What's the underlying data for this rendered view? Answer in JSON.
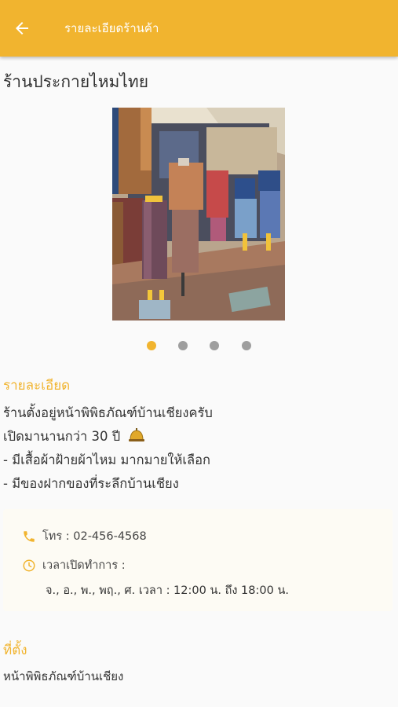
{
  "appbar": {
    "title": "รายละเอียดร้านค้า",
    "back_icon": "arrow-left-icon"
  },
  "shop": {
    "name": "ร้านประกายไหมไทย"
  },
  "carousel": {
    "total": 4,
    "active_index": 0
  },
  "details": {
    "heading": "รายละเอียด",
    "lines": [
      "ร้านตั้งอยู่หน้าพิพิธภัณฑ์บ้านเชียงครับ",
      "เปิดมานานกว่า 30 ปี",
      "- มีเสื้อผ้าฝ้ายผ้าไหม มากมายให้เลือก",
      "- มีของฝากของที่ระลึกบ้านเชียง"
    ],
    "emoji_icon": "bell-icon"
  },
  "contact": {
    "phone": "โทร : 02-456-4568",
    "hours_label": "เวลาเปิดทำการ :",
    "hours_value": "จ., อ., พ., พฤ., ศ. เวลา : 12:00 น. ถึง 18:00 น."
  },
  "location": {
    "heading": "ที่ตั้ง",
    "text": "หน้าพิพิธภัณฑ์บ้านเชียง"
  },
  "colors": {
    "accent": "#f1b42f",
    "text": "#333333",
    "background": "#fafafa"
  }
}
